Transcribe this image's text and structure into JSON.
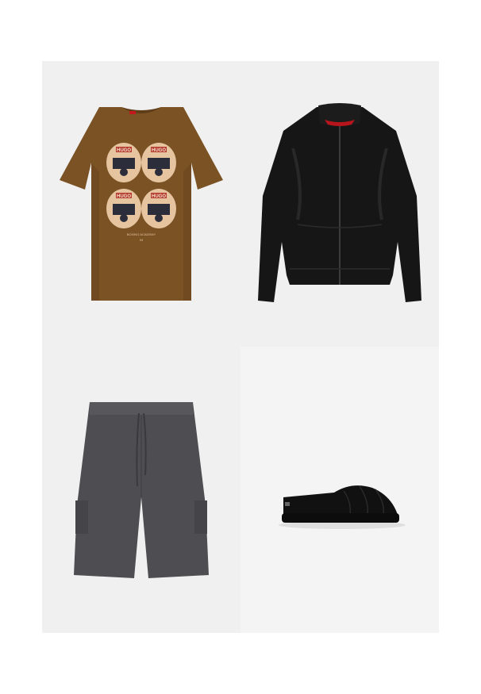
{
  "outfit": {
    "items": [
      {
        "name": "t-shirt",
        "color": "#7a5224",
        "bg": "#f0f0f0"
      },
      {
        "name": "leather-jacket",
        "color": "#161616",
        "bg": "#f0f0f0"
      },
      {
        "name": "cargo-shorts",
        "color": "#4e4e52",
        "bg": "#f0f0f0"
      },
      {
        "name": "slipper",
        "color": "#111111",
        "bg": "#f4f4f4"
      }
    ],
    "print": {
      "brand_text": "HUGO",
      "caption": "BOXING ACADEMY",
      "number": "93"
    }
  }
}
